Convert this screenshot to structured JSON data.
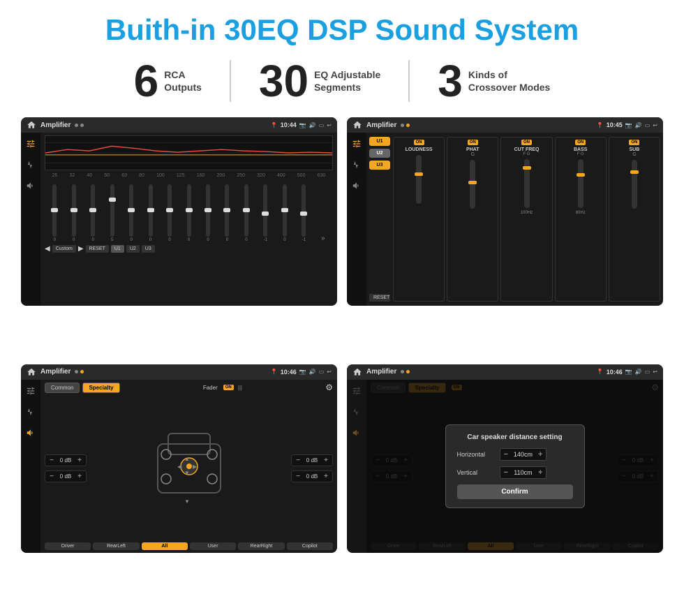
{
  "page": {
    "title": "Buith-in 30EQ DSP Sound System",
    "stats": [
      {
        "number": "6",
        "label": "RCA\nOutputs"
      },
      {
        "number": "30",
        "label": "EQ Adjustable\nSegments"
      },
      {
        "number": "3",
        "label": "Kinds of\nCrossover Modes"
      }
    ]
  },
  "screens": {
    "eq": {
      "title": "Amplifier",
      "time": "10:44",
      "frequencies": [
        "25",
        "32",
        "40",
        "50",
        "63",
        "80",
        "100",
        "125",
        "160",
        "200",
        "250",
        "320",
        "400",
        "500",
        "630"
      ],
      "values": [
        "0",
        "0",
        "0",
        "5",
        "0",
        "0",
        "0",
        "0",
        "0",
        "0",
        "0",
        "-1",
        "0",
        "-1"
      ],
      "buttons": [
        "Custom",
        "RESET",
        "U1",
        "U2",
        "U3"
      ]
    },
    "amp": {
      "title": "Amplifier",
      "time": "10:45",
      "presets": [
        "U1",
        "U2",
        "U3"
      ],
      "channels": [
        {
          "name": "LOUDNESS",
          "on": true
        },
        {
          "name": "PHAT",
          "on": true
        },
        {
          "name": "CUT FREQ",
          "on": true
        },
        {
          "name": "BASS",
          "on": true
        },
        {
          "name": "SUB",
          "on": true
        }
      ],
      "reset_label": "RESET"
    },
    "fader": {
      "title": "Amplifier",
      "time": "10:46",
      "tabs": [
        "Common",
        "Specialty"
      ],
      "active_tab": "Specialty",
      "fader_label": "Fader",
      "on_label": "ON",
      "controls": [
        {
          "label": "0 dB"
        },
        {
          "label": "0 dB"
        },
        {
          "label": "0 dB"
        },
        {
          "label": "0 dB"
        }
      ],
      "buttons": [
        "Driver",
        "RearLeft",
        "All",
        "User",
        "RearRight",
        "Copilot"
      ]
    },
    "dialog": {
      "title": "Amplifier",
      "time": "10:46",
      "dialog_title": "Car speaker distance setting",
      "fields": [
        {
          "label": "Horizontal",
          "value": "140cm"
        },
        {
          "label": "Vertical",
          "value": "110cm"
        }
      ],
      "confirm_label": "Confirm",
      "tabs": [
        "Common",
        "Specialty"
      ],
      "db_controls": [
        {
          "label": "0 dB"
        },
        {
          "label": "0 dB"
        }
      ],
      "buttons": [
        "Driver",
        "RearLeft",
        "All",
        "User",
        "RearRight",
        "Copilot"
      ]
    }
  }
}
